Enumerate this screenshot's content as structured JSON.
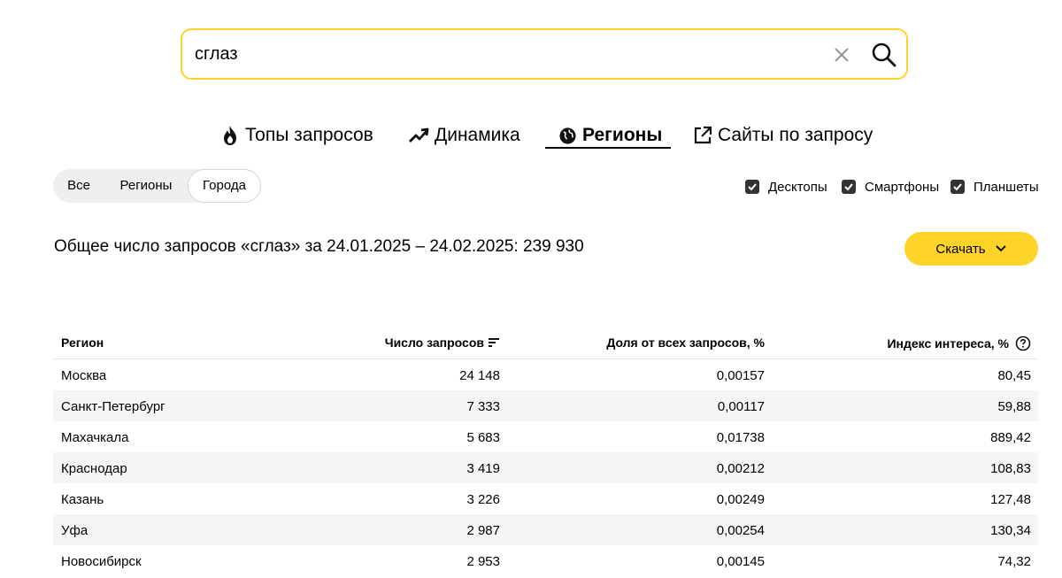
{
  "search": {
    "value": "сглаз",
    "placeholder": ""
  },
  "tabs": [
    {
      "label": "Топы запросов",
      "icon": "fire-icon"
    },
    {
      "label": "Динамика",
      "icon": "trend-up-icon"
    },
    {
      "label": "Регионы",
      "icon": "globe-icon",
      "active": true
    },
    {
      "label": "Сайты по запросу",
      "icon": "external-link-icon"
    }
  ],
  "segments": [
    {
      "label": "Все"
    },
    {
      "label": "Регионы"
    },
    {
      "label": "Города",
      "active": true
    }
  ],
  "devices": [
    {
      "label": "Десктопы",
      "checked": true
    },
    {
      "label": "Смартфоны",
      "checked": true
    },
    {
      "label": "Планшеты",
      "checked": true
    }
  ],
  "total_text": "Общее число запросов «сглаз» за 24.01.2025 – 24.02.2025: 239 930",
  "download_label": "Скачать",
  "table": {
    "headers": {
      "region": "Регион",
      "count": "Число запросов",
      "share": "Доля от всех запросов, %",
      "index": "Индекс интереса, %"
    },
    "rows": [
      {
        "region": "Москва",
        "count": "24 148",
        "share": "0,00157",
        "index": "80,45"
      },
      {
        "region": "Санкт-Петербург",
        "count": "7 333",
        "share": "0,00117",
        "index": "59,88"
      },
      {
        "region": "Махачкала",
        "count": "5 683",
        "share": "0,01738",
        "index": "889,42"
      },
      {
        "region": "Краснодар",
        "count": "3 419",
        "share": "0,00212",
        "index": "108,83"
      },
      {
        "region": "Казань",
        "count": "3 226",
        "share": "0,00249",
        "index": "127,48"
      },
      {
        "region": "Уфа",
        "count": "2 987",
        "share": "0,00254",
        "index": "130,34"
      },
      {
        "region": "Новосибирск",
        "count": "2 953",
        "share": "0,00145",
        "index": "74,32"
      }
    ]
  },
  "colors": {
    "accent": "#fed42b",
    "row_alt": "#f5f5f5"
  }
}
